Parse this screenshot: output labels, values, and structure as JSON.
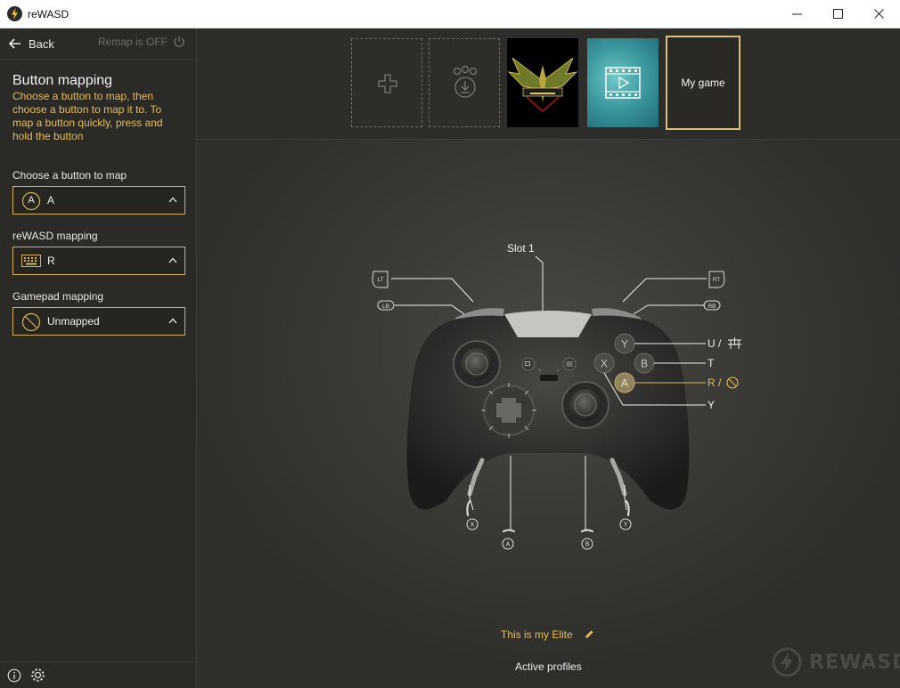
{
  "app": {
    "title": "reWASD"
  },
  "sidebar": {
    "back_label": "Back",
    "remap_status": "Remap is OFF",
    "title": "Button mapping",
    "description": "Choose a button to map, then choose a button to map it to. To map a button quickly, press and hold the button",
    "choose_label": "Choose a button to map",
    "choose_icon_letter": "A",
    "choose_value": "A",
    "rewasd_label": "reWASD mapping",
    "rewasd_value": "R",
    "gamepad_label": "Gamepad mapping",
    "gamepad_value": "Unmapped"
  },
  "profiles": {
    "items": [
      {
        "kind": "add",
        "icon": "plus-icon"
      },
      {
        "kind": "community",
        "icon": "community-download-icon"
      },
      {
        "kind": "game",
        "name": "Elite",
        "icon": "elite-logo"
      },
      {
        "kind": "game",
        "name": "video",
        "icon": "video-icon"
      },
      {
        "kind": "game",
        "label": "My game",
        "selected": true
      }
    ]
  },
  "controller": {
    "slot_label": "Slot 1",
    "bumpers": {
      "lt": "LT",
      "lb": "LB",
      "rt": "RT",
      "rb": "RB"
    },
    "face_buttons": {
      "y": "Y",
      "b": "B",
      "x": "X",
      "a": "A"
    },
    "mappings": {
      "y_label": "U",
      "b_label": "T",
      "a_label": "R",
      "x_label": "Y",
      "sep": "/"
    },
    "paddles": {
      "left_outer": "X",
      "left_inner": "A",
      "right_inner": "B",
      "right_outer": "Y"
    }
  },
  "footer": {
    "profile_name": "This is my Elite",
    "active_profiles": "Active profiles",
    "watermark": "REWASD"
  },
  "colors": {
    "accent": "#e6be5a",
    "accent_border": "#d4b25a",
    "bg": "#2f2e2b"
  }
}
